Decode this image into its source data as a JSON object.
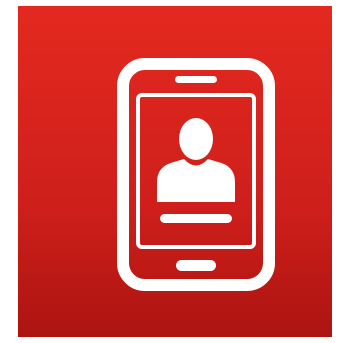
{
  "icon": {
    "name": "mobile-contact-icon",
    "colors": {
      "background_top": "#e3291f",
      "background_bottom": "#ac1411",
      "glyph": "#ffffff"
    }
  }
}
